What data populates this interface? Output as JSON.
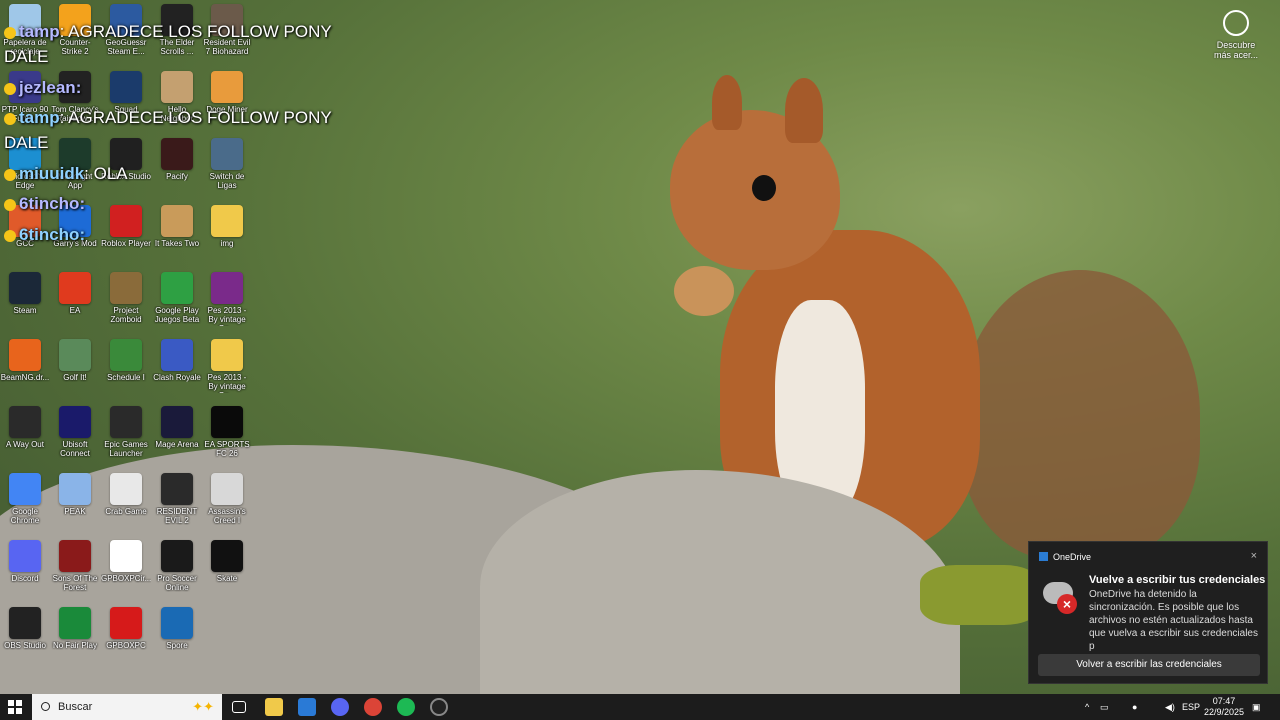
{
  "desktop_icons": [
    {
      "label": "Papelera de reciclaje",
      "color": "#9fc7e8"
    },
    {
      "label": "Counter-Strike 2",
      "color": "#f3a21c"
    },
    {
      "label": "GeoGuessr Steam E...",
      "color": "#2c5aa0"
    },
    {
      "label": "The Elder Scrolls ...",
      "color": "#222222"
    },
    {
      "label": "Resident Evil 7 Biohazard",
      "color": "#6b5a4a"
    },
    {
      "label": "PTP Icaro 90 Fund...",
      "color": "#3a3a8a"
    },
    {
      "label": "Tom Clancy's Rainbow...",
      "color": "#222222"
    },
    {
      "label": "Squad",
      "color": "#1b3b6b"
    },
    {
      "label": "Hello Neighbor",
      "color": "#c4a070"
    },
    {
      "label": "Doge Miner",
      "color": "#e89b3c"
    },
    {
      "label": "Microsoft Edge",
      "color": "#1c8fd1"
    },
    {
      "label": "Moonlight App",
      "color": "#1d3b2b"
    },
    {
      "label": "Roblox Studio",
      "color": "#202020"
    },
    {
      "label": "Pacify",
      "color": "#3a1a1a"
    },
    {
      "label": "Switch de Ligas",
      "color": "#4a6b8a"
    },
    {
      "label": "GCC",
      "color": "#e05a2a"
    },
    {
      "label": "Garry's Mod",
      "color": "#1d6bd6"
    },
    {
      "label": "Roblox Player",
      "color": "#d12020"
    },
    {
      "label": "It Takes Two",
      "color": "#c99b5a"
    },
    {
      "label": "img",
      "color": "#f0c94a"
    },
    {
      "label": "Steam",
      "color": "#1b2838"
    },
    {
      "label": "EA",
      "color": "#e03a1e"
    },
    {
      "label": "Project Zomboid",
      "color": "#8a6b3a"
    },
    {
      "label": "Google Play Juegos Beta",
      "color": "#2ea043"
    },
    {
      "label": "Pes 2013 - By vintage Ga...",
      "color": "#7a2a8a"
    },
    {
      "label": "BeamNG.dr...",
      "color": "#e8641c"
    },
    {
      "label": "Golf It!",
      "color": "#5a8a5a"
    },
    {
      "label": "Schedule I",
      "color": "#3a8a3a"
    },
    {
      "label": "Clash Royale",
      "color": "#3a5ac4"
    },
    {
      "label": "Pes 2013 - By vintage Ga...",
      "color": "#f0c94a"
    },
    {
      "label": "A Way Out",
      "color": "#2a2a2a"
    },
    {
      "label": "Ubisoft Connect",
      "color": "#1a1a6a"
    },
    {
      "label": "Epic Games Launcher",
      "color": "#2a2a2a"
    },
    {
      "label": "Mage Arena",
      "color": "#1a1a3a"
    },
    {
      "label": "EA SPORTS FC 26",
      "color": "#0a0a0a"
    },
    {
      "label": "Google Chrome",
      "color": "#4285f4"
    },
    {
      "label": "PEAK",
      "color": "#8ab4e8"
    },
    {
      "label": "Crab Game",
      "color": "#e8e8e8"
    },
    {
      "label": "RESIDENT EVIL 2",
      "color": "#2a2a2a"
    },
    {
      "label": "Assassin's Creed I",
      "color": "#d8d8d8"
    },
    {
      "label": "Discord",
      "color": "#5865f2"
    },
    {
      "label": "Sons Of The Forest",
      "color": "#8a1a1a"
    },
    {
      "label": "GPBOXPCir...",
      "color": "#ffffff"
    },
    {
      "label": "Pro Soccer Online",
      "color": "#1a1a1a"
    },
    {
      "label": "Skate",
      "color": "#111111"
    },
    {
      "label": "OBS Studio",
      "color": "#222222"
    },
    {
      "label": "No Fair Play",
      "color": "#1a8a3a"
    },
    {
      "label": "GPBOXPC",
      "color": "#d61a1a"
    },
    {
      "label": "Spore",
      "color": "#1a6ab4"
    }
  ],
  "chat": [
    {
      "user": "tamp",
      "message": ": AGRADECE LOS FOLLOW PONY"
    },
    {
      "user": "",
      "message": "DALE"
    },
    {
      "user": "jezlean:",
      "message": ""
    },
    {
      "user": "tamp",
      "message": ": AGRADECE LOS FOLLOW PONY"
    },
    {
      "user": "",
      "message": "DALE"
    },
    {
      "user": "miuuidk",
      "message": ": OLA"
    },
    {
      "user": "6tincho:",
      "message": ""
    },
    {
      "user": "6tincho:",
      "message": ""
    }
  ],
  "discover": {
    "label": "Descubre más acer..."
  },
  "toast": {
    "app": "OneDrive",
    "title": "Vuelve a escribir tus credenciales",
    "body": "OneDrive ha detenido la sincronización. Es posible que los archivos no estén actualizados hasta que vuelva a escribir sus credenciales p",
    "button": "Volver a escribir las credenciales",
    "close": "×"
  },
  "taskbar": {
    "search_placeholder": "Buscar",
    "lang": "ESP",
    "time": "07:47",
    "date": "22/9/2025"
  }
}
